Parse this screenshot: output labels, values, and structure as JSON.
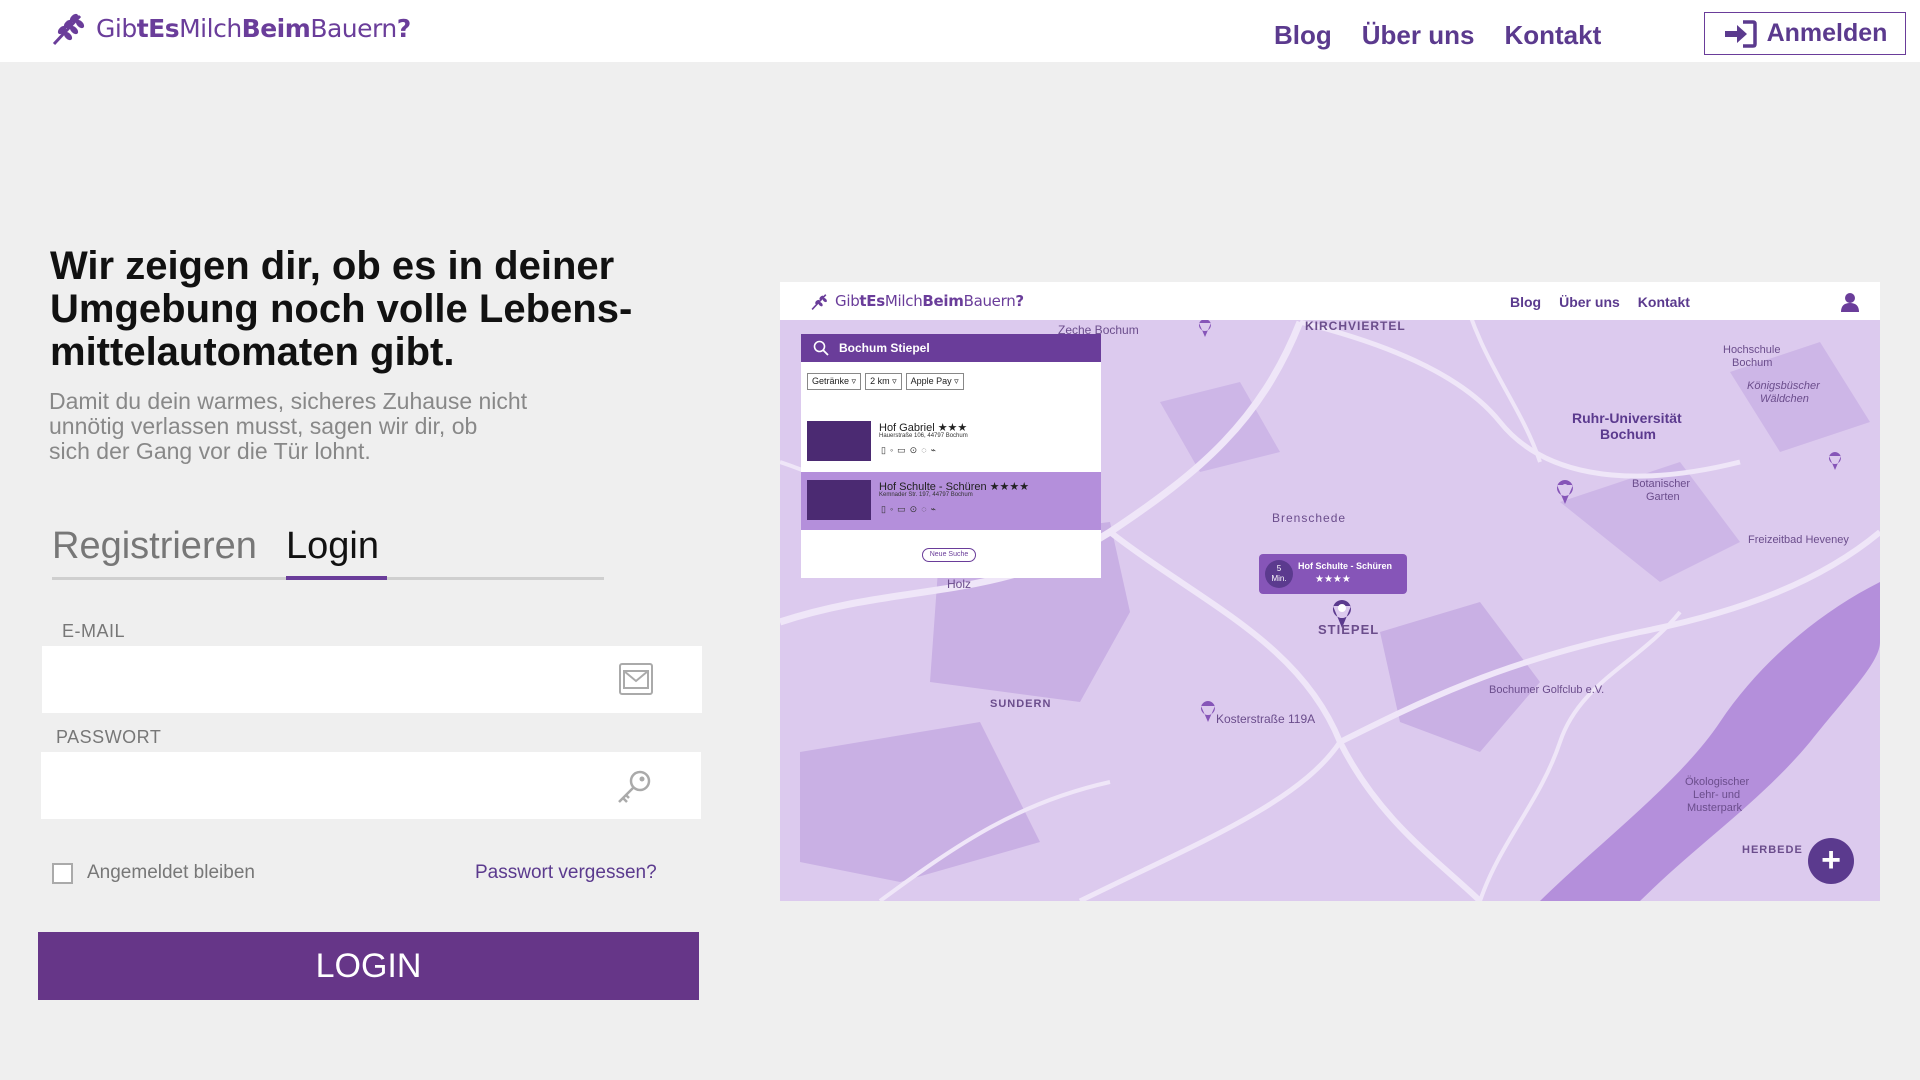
{
  "header": {
    "logo": {
      "part1": "Gib",
      "part2": "tEs",
      "part3": "Milch",
      "part4": "Beim",
      "part5": "Bauern",
      "part6": "?"
    },
    "nav": [
      "Blog",
      "Über uns",
      "Kontakt"
    ],
    "signin_label": "Anmelden"
  },
  "hero": {
    "line1": "Wir zeigen dir, ob es in deiner",
    "line2": "Umgebung noch volle  Lebens-",
    "line3": "mittelautomaten gibt.",
    "sub1": "Damit du dein warmes, sicheres Zuhause nicht",
    "sub2": "unnötig verlassen musst, sagen wir dir, ob",
    "sub3": "sich der Gang vor die Tür lohnt."
  },
  "tabs": {
    "register": "Registrieren",
    "login": "Login"
  },
  "form": {
    "email_label": "E-MAIL",
    "password_label": "PASSWORT",
    "remember_label": "Angemeldet bleiben",
    "forgot_label": "Passwort vergessen?",
    "submit_label": "LOGIN"
  },
  "preview": {
    "nav": [
      "Blog",
      "Über uns",
      "Kontakt"
    ],
    "search": {
      "query": "Bochum Stiepel",
      "filters": [
        "Getränke",
        "2 km",
        "Apple Pay"
      ],
      "results": [
        {
          "name": "Hof Gabriel ★★★",
          "address": "Hauerstraße 106, 44797 Bochum"
        },
        {
          "name": "Hof Schulte - Schüren ★★★★",
          "address": "Kemnader Str. 197, 44797 Bochum"
        }
      ],
      "new_search": "Neue Suche"
    },
    "bubble": {
      "time": "5",
      "unit": "Min.",
      "name": "Hof Schulte - Schüren",
      "stars": "★★★★"
    },
    "map_labels": {
      "zeche": "Zeche Bochum",
      "kirchviertel": "KIRCHVIERTEL",
      "hochschule": "Hochschule",
      "hochschule2": "Bochum",
      "koenigsbuesch": "Königsbüscher",
      "koenigsbuesch2": "Wäldchen",
      "rub1": "Ruhr-Universität",
      "rub2": "Bochum",
      "botanischer": "Botanischer",
      "botanischer2": "Garten",
      "brenschede": "Brenschede",
      "freizeitbad": "Freizeitbad Heveney",
      "holz": "Holz",
      "stiepel": "STIEPEL",
      "sundern": "SUNDERN",
      "kosterstrasse": "Kosterstraße 119A",
      "golfclub": "Bochumer Golfclub e.V.",
      "oekologischer1": "Ökologischer",
      "oekologischer2": "Lehr- und",
      "oekologischer3": "Musterpark",
      "herbede": "HERBEDE"
    }
  },
  "colors": {
    "brand": "#663688",
    "accent": "#6a3d9a",
    "map": "#dcc9ee"
  }
}
